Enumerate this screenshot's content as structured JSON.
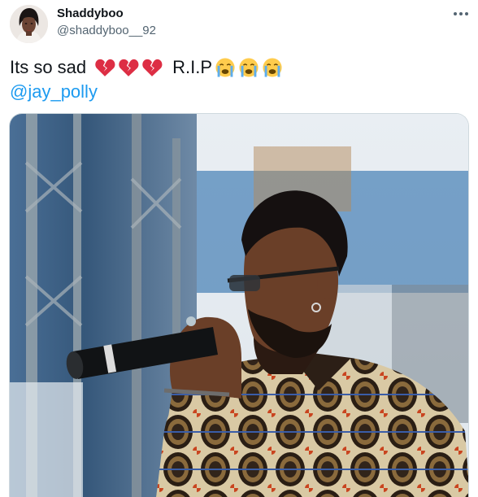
{
  "tweet": {
    "display_name": "Shaddyboo",
    "handle": "@shaddyboo__92",
    "text_before": "Its so sad",
    "text_after": "R.I.P",
    "mention": "@jay_polly",
    "broken_heart_emoji_count": 3,
    "crying_emoji_count": 3
  },
  "icons": {
    "more": "more-options-icon",
    "broken_heart": "broken-heart-emoji",
    "crying": "loudly-crying-face-emoji"
  },
  "colors": {
    "text": "#0f1419",
    "muted": "#536471",
    "link": "#1d9bf0",
    "heart": "#dd2e44",
    "emoji_face": "#ffcc4d",
    "tears": "#5dadec"
  }
}
